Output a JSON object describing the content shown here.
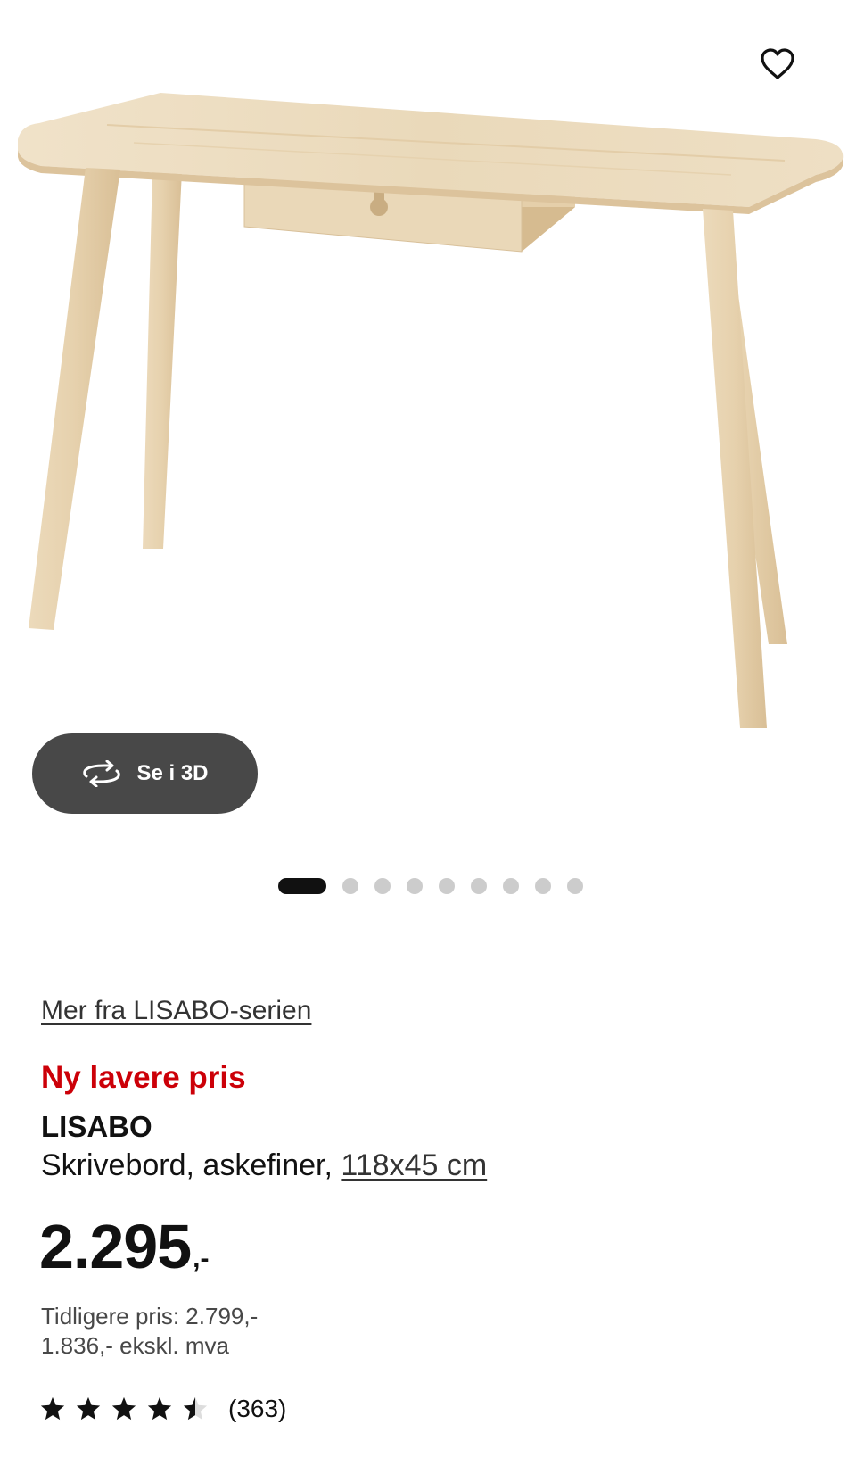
{
  "product": {
    "image_alt": "LISABO skrivebord",
    "favorite_icon": "heart-icon",
    "view3d": {
      "icon": "rotate-3d-icon",
      "label": "Se i 3D"
    },
    "carousel": {
      "total_images": 9,
      "active_index": 0
    },
    "series_link": "Mer fra LISABO-serien",
    "promo_label": "Ny lavere pris",
    "name": "LISABO",
    "description": "Skrivebord, askefiner, ",
    "size_link": "118x45 cm",
    "price": {
      "amount": "2.295",
      "suffix": ",-"
    },
    "previous_price": "Tidligere pris: 2.799,-",
    "price_ex_vat": "1.836,- ekskl. mva",
    "rating": {
      "stars": 4.5,
      "max_stars": 5,
      "count_label": "(363)"
    }
  },
  "colors": {
    "promo_red": "#cc0008",
    "button_dark": "#484848",
    "dot_active": "#111111",
    "dot_inactive": "#cccccc",
    "wood_light": "#eddcbf",
    "wood_mid": "#e2cba5",
    "wood_dark": "#cfb48a"
  }
}
